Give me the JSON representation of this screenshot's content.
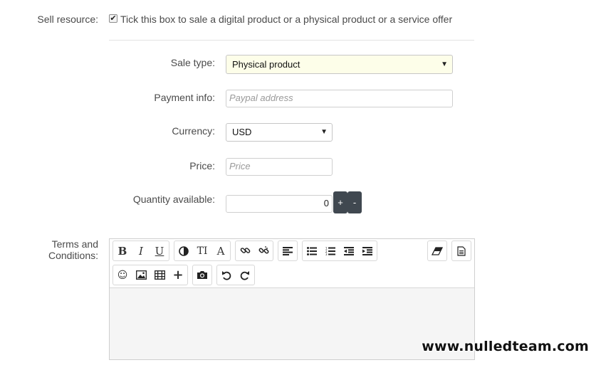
{
  "sell": {
    "label": "Sell resource:",
    "checked": true,
    "checkbox_text": "Tick this box to sale a digital product or a physical product or a service offer"
  },
  "sale_type": {
    "label": "Sale type:",
    "value": "Physical product"
  },
  "payment": {
    "label": "Payment info:",
    "placeholder": "Paypal address"
  },
  "currency": {
    "label": "Currency:",
    "value": "USD"
  },
  "price": {
    "label": "Price:",
    "placeholder": "Price"
  },
  "quantity": {
    "label": "Quantity available:",
    "value": "0",
    "plus_label": "+",
    "minus_label": "-"
  },
  "terms": {
    "label": "Terms and Conditions:",
    "toolbar_row1": [
      "bold-icon",
      "italic-icon",
      "underline-icon",
      "text-color-icon",
      "font-size-icon",
      "font-family-icon",
      "link-icon",
      "unlink-icon",
      "align-left-icon",
      "bullet-list-icon",
      "numbered-list-icon",
      "outdent-icon",
      "indent-icon",
      "remove-format-icon",
      "source-icon"
    ],
    "toolbar_row2": [
      "smiley-icon",
      "image-icon",
      "media-icon",
      "insert-icon",
      "camera-icon",
      "undo-icon",
      "redo-icon"
    ],
    "button_glyphs": {
      "bold": "B",
      "italic": "I",
      "underline": "U",
      "font_size": "TI",
      "font_family": "A"
    }
  },
  "watermark": "www.nulledteam.com"
}
